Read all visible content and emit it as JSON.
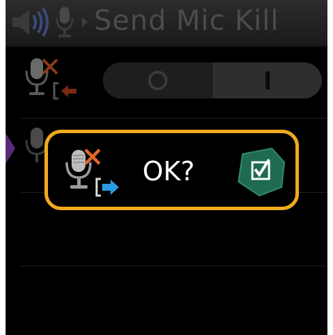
{
  "header": {
    "title": "Send Mic Kill",
    "icons": [
      "speaker-icon",
      "microphone-icon",
      "chevron-right-icon"
    ]
  },
  "setting_row": {
    "icon": "mic-kill-receive-icon",
    "toggle": {
      "off_glyph": "O",
      "on_glyph": "I",
      "selected": "I"
    }
  },
  "dialog": {
    "question": "OK?",
    "icon": "mic-kill-send-icon",
    "confirm_icon": "checkbox-checked-icon"
  },
  "colors": {
    "dialog_border": "#f0aa1e",
    "confirm_green": "#1f6b4f",
    "selection_tab": "#5a2a7a",
    "arrow_orange": "#c9411a",
    "arrow_blue": "#2a9ae0",
    "cross_orange": "#e2672a"
  }
}
